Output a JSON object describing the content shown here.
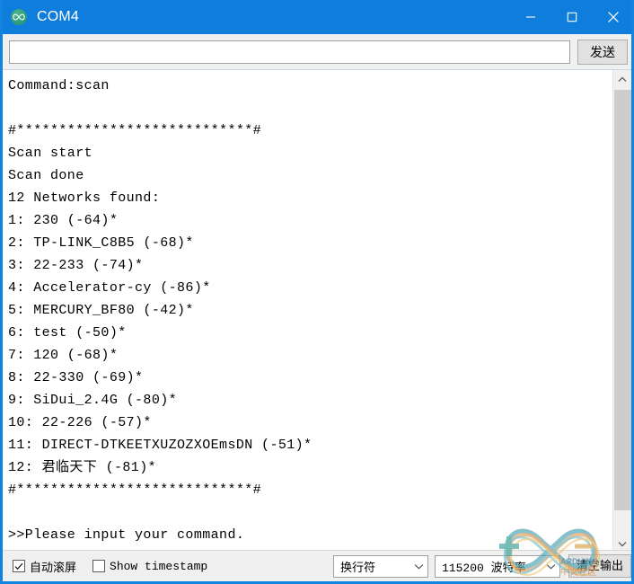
{
  "window": {
    "title": "COM4",
    "app_icon": "arduino-infinity-icon",
    "accent_color": "#0f7ddb",
    "controls": {
      "minimize": "minimize-icon",
      "maximize": "maximize-icon",
      "close": "close-icon"
    }
  },
  "command_bar": {
    "input_value": "",
    "input_placeholder": "",
    "send_label": "发送"
  },
  "console": {
    "lines": [
      "Command:scan",
      "",
      "#****************************#",
      "Scan start",
      "Scan done",
      "12 Networks found:",
      "1: 230 (-64)*",
      "2: TP-LINK_C8B5 (-68)*",
      "3: 22-233 (-74)*",
      "4: Accelerator-cy (-86)*",
      "5: MERCURY_BF80 (-42)*",
      "6: test (-50)*",
      "7: 120 (-68)*",
      "8: 22-330 (-69)*",
      "9: SiDui_2.4G (-80)*",
      "10: 22-226 (-57)*",
      "11: DIRECT-DTKEETXUZOZXOEmsDN (-51)*",
      "12: 君临天下 (-81)*",
      "#****************************#",
      "",
      ">>Please input your command."
    ],
    "text_color": "#000000",
    "background_color": "#ffffff"
  },
  "scrollbar": {
    "up_arrow": "chevron-up-icon",
    "down_arrow": "chevron-down-icon"
  },
  "status_bar": {
    "autoscroll": {
      "label": "自动滚屏",
      "checked": true
    },
    "show_timestamp": {
      "label": "Show timestamp",
      "checked": false
    },
    "line_ending": {
      "selected": "换行符"
    },
    "baud_rate": {
      "selected": "115200 波特率"
    },
    "clear_output_label": "清空输出"
  },
  "watermark": {
    "name": "arduino-logo-watermark"
  }
}
